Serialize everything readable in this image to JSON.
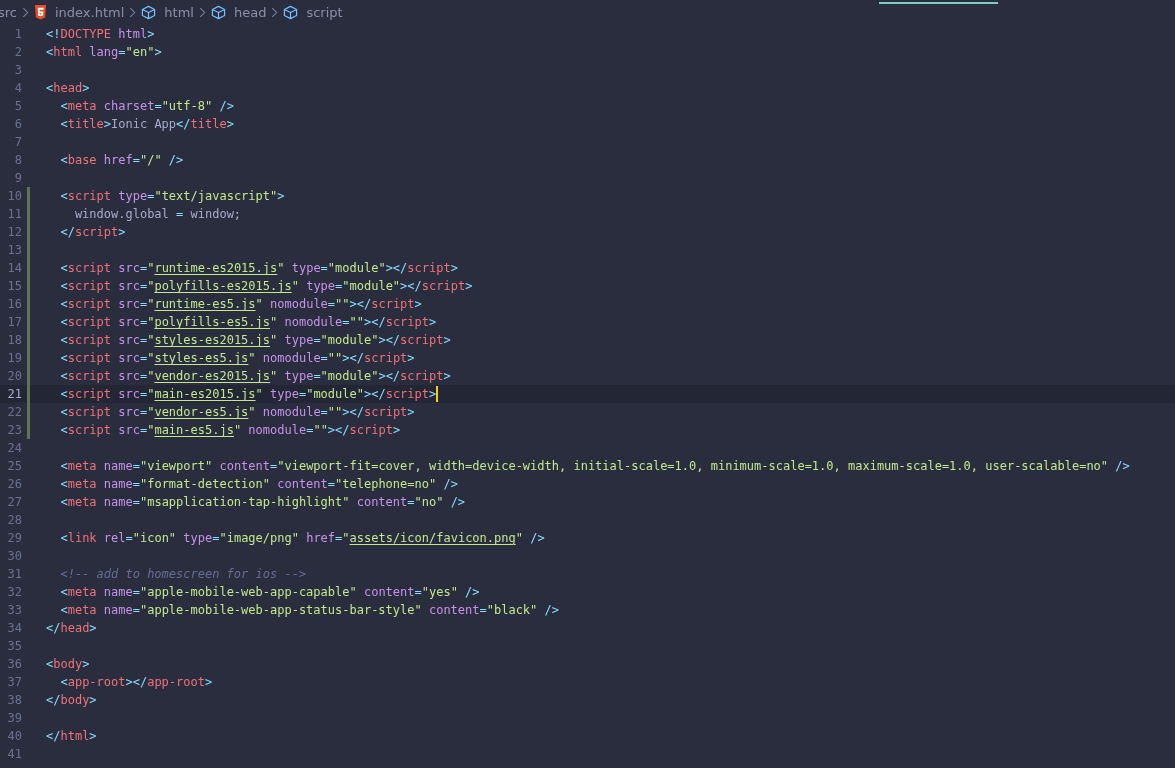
{
  "breadcrumbs": [
    {
      "kind": "folder",
      "label": "src"
    },
    {
      "kind": "file",
      "label": "index.html"
    },
    {
      "kind": "element",
      "label": "html"
    },
    {
      "kind": "element",
      "label": "head"
    },
    {
      "kind": "element",
      "label": "script"
    }
  ],
  "editor": {
    "lines": [
      {
        "number": "1",
        "changed": false,
        "current": false,
        "tokens": [
          {
            "kind": "punct",
            "text": "<!"
          },
          {
            "kind": "tag",
            "text": "DOCTYPE"
          },
          {
            "kind": "attr",
            "text": " html"
          },
          {
            "kind": "punct",
            "text": ">"
          }
        ]
      },
      {
        "number": "2",
        "changed": false,
        "current": false,
        "tokens": [
          {
            "kind": "punct",
            "text": "<"
          },
          {
            "kind": "tag",
            "text": "html"
          },
          {
            "kind": "attr",
            "text": " lang"
          },
          {
            "kind": "punct",
            "text": "="
          },
          {
            "kind": "string",
            "text": "\"en\""
          },
          {
            "kind": "punct",
            "text": ">"
          }
        ]
      },
      {
        "number": "3",
        "changed": false,
        "current": false
      },
      {
        "number": "4",
        "changed": false,
        "current": false,
        "tokens": [
          {
            "kind": "punct",
            "text": "<"
          },
          {
            "kind": "tag",
            "text": "head"
          },
          {
            "kind": "punct",
            "text": ">"
          }
        ]
      },
      {
        "number": "5",
        "changed": false,
        "current": false,
        "tokens": [
          {
            "kind": "punct",
            "text": "  <"
          },
          {
            "kind": "tag",
            "text": "meta"
          },
          {
            "kind": "attr",
            "text": " charset"
          },
          {
            "kind": "punct",
            "text": "="
          },
          {
            "kind": "string",
            "text": "\"utf-8\""
          },
          {
            "kind": "punct",
            "text": " />"
          }
        ]
      },
      {
        "number": "6",
        "changed": false,
        "current": false,
        "tokens": [
          {
            "kind": "punct",
            "text": "  <"
          },
          {
            "kind": "tag",
            "text": "title"
          },
          {
            "kind": "punct",
            "text": ">"
          },
          {
            "kind": "text",
            "text": "Ionic App"
          },
          {
            "kind": "punct",
            "text": "</"
          },
          {
            "kind": "tag",
            "text": "title"
          },
          {
            "kind": "punct",
            "text": ">"
          }
        ]
      },
      {
        "number": "7",
        "changed": false,
        "current": false
      },
      {
        "number": "8",
        "changed": false,
        "current": false,
        "tokens": [
          {
            "kind": "punct",
            "text": "  <"
          },
          {
            "kind": "tag",
            "text": "base"
          },
          {
            "kind": "attr",
            "text": " href"
          },
          {
            "kind": "punct",
            "text": "="
          },
          {
            "kind": "string",
            "text": "\"/\""
          },
          {
            "kind": "punct",
            "text": " />"
          }
        ]
      },
      {
        "number": "9",
        "changed": false,
        "current": false
      },
      {
        "number": "10",
        "changed": true,
        "current": false,
        "tokens": [
          {
            "kind": "punct",
            "text": "  <"
          },
          {
            "kind": "tag",
            "text": "script"
          },
          {
            "kind": "attr",
            "text": " type"
          },
          {
            "kind": "punct",
            "text": "="
          },
          {
            "kind": "string",
            "text": "\"text/javascript\""
          },
          {
            "kind": "punct",
            "text": ">"
          }
        ]
      },
      {
        "number": "11",
        "changed": true,
        "current": false,
        "tokens": [
          {
            "kind": "text",
            "text": "    window.global"
          },
          {
            "kind": "punct",
            "text": " ="
          },
          {
            "kind": "text",
            "text": " window;"
          }
        ]
      },
      {
        "number": "12",
        "changed": true,
        "current": false,
        "tokens": [
          {
            "kind": "punct",
            "text": "  </"
          },
          {
            "kind": "tag",
            "text": "script"
          },
          {
            "kind": "punct",
            "text": ">"
          }
        ]
      },
      {
        "number": "13",
        "changed": true,
        "current": false
      },
      {
        "number": "14",
        "changed": true,
        "current": false,
        "tokens": [
          {
            "kind": "punct",
            "text": "  <"
          },
          {
            "kind": "tag",
            "text": "script"
          },
          {
            "kind": "attr",
            "text": " src"
          },
          {
            "kind": "punct",
            "text": "="
          },
          {
            "kind": "string",
            "text": "\""
          },
          {
            "kind": "link",
            "text": "runtime-es2015.js"
          },
          {
            "kind": "string",
            "text": "\""
          },
          {
            "kind": "attr",
            "text": " type"
          },
          {
            "kind": "punct",
            "text": "="
          },
          {
            "kind": "string",
            "text": "\"module\""
          },
          {
            "kind": "punct",
            "text": "></"
          },
          {
            "kind": "tag",
            "text": "script"
          },
          {
            "kind": "punct",
            "text": ">"
          }
        ]
      },
      {
        "number": "15",
        "changed": true,
        "current": false,
        "tokens": [
          {
            "kind": "punct",
            "text": "  <"
          },
          {
            "kind": "tag",
            "text": "script"
          },
          {
            "kind": "attr",
            "text": " src"
          },
          {
            "kind": "punct",
            "text": "="
          },
          {
            "kind": "string",
            "text": "\""
          },
          {
            "kind": "link",
            "text": "polyfills-es2015.js"
          },
          {
            "kind": "string",
            "text": "\""
          },
          {
            "kind": "attr",
            "text": " type"
          },
          {
            "kind": "punct",
            "text": "="
          },
          {
            "kind": "string",
            "text": "\"module\""
          },
          {
            "kind": "punct",
            "text": "></"
          },
          {
            "kind": "tag",
            "text": "script"
          },
          {
            "kind": "punct",
            "text": ">"
          }
        ]
      },
      {
        "number": "16",
        "changed": true,
        "current": false,
        "tokens": [
          {
            "kind": "punct",
            "text": "  <"
          },
          {
            "kind": "tag",
            "text": "script"
          },
          {
            "kind": "attr",
            "text": " src"
          },
          {
            "kind": "punct",
            "text": "="
          },
          {
            "kind": "string",
            "text": "\""
          },
          {
            "kind": "link",
            "text": "runtime-es5.js"
          },
          {
            "kind": "string",
            "text": "\""
          },
          {
            "kind": "attr",
            "text": " nomodule"
          },
          {
            "kind": "punct",
            "text": "="
          },
          {
            "kind": "string",
            "text": "\"\""
          },
          {
            "kind": "punct",
            "text": "></"
          },
          {
            "kind": "tag",
            "text": "script"
          },
          {
            "kind": "punct",
            "text": ">"
          }
        ]
      },
      {
        "number": "17",
        "changed": true,
        "current": false,
        "tokens": [
          {
            "kind": "punct",
            "text": "  <"
          },
          {
            "kind": "tag",
            "text": "script"
          },
          {
            "kind": "attr",
            "text": " src"
          },
          {
            "kind": "punct",
            "text": "="
          },
          {
            "kind": "string",
            "text": "\""
          },
          {
            "kind": "link",
            "text": "polyfills-es5.js"
          },
          {
            "kind": "string",
            "text": "\""
          },
          {
            "kind": "attr",
            "text": " nomodule"
          },
          {
            "kind": "punct",
            "text": "="
          },
          {
            "kind": "string",
            "text": "\"\""
          },
          {
            "kind": "punct",
            "text": "></"
          },
          {
            "kind": "tag",
            "text": "script"
          },
          {
            "kind": "punct",
            "text": ">"
          }
        ]
      },
      {
        "number": "18",
        "changed": true,
        "current": false,
        "tokens": [
          {
            "kind": "punct",
            "text": "  <"
          },
          {
            "kind": "tag",
            "text": "script"
          },
          {
            "kind": "attr",
            "text": " src"
          },
          {
            "kind": "punct",
            "text": "="
          },
          {
            "kind": "string",
            "text": "\""
          },
          {
            "kind": "link",
            "text": "styles-es2015.js"
          },
          {
            "kind": "string",
            "text": "\""
          },
          {
            "kind": "attr",
            "text": " type"
          },
          {
            "kind": "punct",
            "text": "="
          },
          {
            "kind": "string",
            "text": "\"module\""
          },
          {
            "kind": "punct",
            "text": "></"
          },
          {
            "kind": "tag",
            "text": "script"
          },
          {
            "kind": "punct",
            "text": ">"
          }
        ]
      },
      {
        "number": "19",
        "changed": true,
        "current": false,
        "tokens": [
          {
            "kind": "punct",
            "text": "  <"
          },
          {
            "kind": "tag",
            "text": "script"
          },
          {
            "kind": "attr",
            "text": " src"
          },
          {
            "kind": "punct",
            "text": "="
          },
          {
            "kind": "string",
            "text": "\""
          },
          {
            "kind": "link",
            "text": "styles-es5.js"
          },
          {
            "kind": "string",
            "text": "\""
          },
          {
            "kind": "attr",
            "text": " nomodule"
          },
          {
            "kind": "punct",
            "text": "="
          },
          {
            "kind": "string",
            "text": "\"\""
          },
          {
            "kind": "punct",
            "text": "></"
          },
          {
            "kind": "tag",
            "text": "script"
          },
          {
            "kind": "punct",
            "text": ">"
          }
        ]
      },
      {
        "number": "20",
        "changed": true,
        "current": false,
        "tokens": [
          {
            "kind": "punct",
            "text": "  <"
          },
          {
            "kind": "tag",
            "text": "script"
          },
          {
            "kind": "attr",
            "text": " src"
          },
          {
            "kind": "punct",
            "text": "="
          },
          {
            "kind": "string",
            "text": "\""
          },
          {
            "kind": "link",
            "text": "vendor-es2015.js"
          },
          {
            "kind": "string",
            "text": "\""
          },
          {
            "kind": "attr",
            "text": " type"
          },
          {
            "kind": "punct",
            "text": "="
          },
          {
            "kind": "string",
            "text": "\"module\""
          },
          {
            "kind": "punct",
            "text": "></"
          },
          {
            "kind": "tag",
            "text": "script"
          },
          {
            "kind": "punct",
            "text": ">"
          }
        ]
      },
      {
        "number": "21",
        "changed": true,
        "current": true,
        "tokens": [
          {
            "kind": "punct",
            "text": "  <"
          },
          {
            "kind": "tag",
            "text": "script"
          },
          {
            "kind": "attr",
            "text": " src"
          },
          {
            "kind": "punct",
            "text": "="
          },
          {
            "kind": "string",
            "text": "\""
          },
          {
            "kind": "link",
            "text": "main-es2015.js"
          },
          {
            "kind": "string",
            "text": "\""
          },
          {
            "kind": "attr",
            "text": " type"
          },
          {
            "kind": "punct",
            "text": "="
          },
          {
            "kind": "string",
            "text": "\"module\""
          },
          {
            "kind": "punct",
            "text": "></"
          },
          {
            "kind": "tag",
            "text": "script"
          },
          {
            "kind": "punct",
            "text": ">"
          }
        ]
      },
      {
        "number": "22",
        "changed": true,
        "current": false,
        "tokens": [
          {
            "kind": "punct",
            "text": "  <"
          },
          {
            "kind": "tag",
            "text": "script"
          },
          {
            "kind": "attr",
            "text": " src"
          },
          {
            "kind": "punct",
            "text": "="
          },
          {
            "kind": "string",
            "text": "\""
          },
          {
            "kind": "link",
            "text": "vendor-es5.js"
          },
          {
            "kind": "string",
            "text": "\""
          },
          {
            "kind": "attr",
            "text": " nomodule"
          },
          {
            "kind": "punct",
            "text": "="
          },
          {
            "kind": "string",
            "text": "\"\""
          },
          {
            "kind": "punct",
            "text": "></"
          },
          {
            "kind": "tag",
            "text": "script"
          },
          {
            "kind": "punct",
            "text": ">"
          }
        ]
      },
      {
        "number": "23",
        "changed": true,
        "current": false,
        "tokens": [
          {
            "kind": "punct",
            "text": "  <"
          },
          {
            "kind": "tag",
            "text": "script"
          },
          {
            "kind": "attr",
            "text": " src"
          },
          {
            "kind": "punct",
            "text": "="
          },
          {
            "kind": "string",
            "text": "\""
          },
          {
            "kind": "link",
            "text": "main-es5.js"
          },
          {
            "kind": "string",
            "text": "\""
          },
          {
            "kind": "attr",
            "text": " nomodule"
          },
          {
            "kind": "punct",
            "text": "="
          },
          {
            "kind": "string",
            "text": "\"\""
          },
          {
            "kind": "punct",
            "text": "></"
          },
          {
            "kind": "tag",
            "text": "script"
          },
          {
            "kind": "punct",
            "text": ">"
          }
        ]
      },
      {
        "number": "24",
        "changed": false,
        "current": false
      },
      {
        "number": "25",
        "changed": false,
        "current": false,
        "tokens": [
          {
            "kind": "punct",
            "text": "  <"
          },
          {
            "kind": "tag",
            "text": "meta"
          },
          {
            "kind": "attr",
            "text": " name"
          },
          {
            "kind": "punct",
            "text": "="
          },
          {
            "kind": "string",
            "text": "\"viewport\""
          },
          {
            "kind": "attr",
            "text": " content"
          },
          {
            "kind": "punct",
            "text": "="
          },
          {
            "kind": "string",
            "text": "\"viewport-fit=cover, width=device-width, initial-scale=1.0, minimum-scale=1.0, maximum-scale=1.0, user-scalable=no\""
          },
          {
            "kind": "punct",
            "text": " />"
          }
        ]
      },
      {
        "number": "26",
        "changed": false,
        "current": false,
        "tokens": [
          {
            "kind": "punct",
            "text": "  <"
          },
          {
            "kind": "tag",
            "text": "meta"
          },
          {
            "kind": "attr",
            "text": " name"
          },
          {
            "kind": "punct",
            "text": "="
          },
          {
            "kind": "string",
            "text": "\"format-detection\""
          },
          {
            "kind": "attr",
            "text": " content"
          },
          {
            "kind": "punct",
            "text": "="
          },
          {
            "kind": "string",
            "text": "\"telephone=no\""
          },
          {
            "kind": "punct",
            "text": " />"
          }
        ]
      },
      {
        "number": "27",
        "changed": false,
        "current": false,
        "tokens": [
          {
            "kind": "punct",
            "text": "  <"
          },
          {
            "kind": "tag",
            "text": "meta"
          },
          {
            "kind": "attr",
            "text": " name"
          },
          {
            "kind": "punct",
            "text": "="
          },
          {
            "kind": "string",
            "text": "\"msapplication-tap-highlight\""
          },
          {
            "kind": "attr",
            "text": " content"
          },
          {
            "kind": "punct",
            "text": "="
          },
          {
            "kind": "string",
            "text": "\"no\""
          },
          {
            "kind": "punct",
            "text": " />"
          }
        ]
      },
      {
        "number": "28",
        "changed": false,
        "current": false
      },
      {
        "number": "29",
        "changed": false,
        "current": false,
        "tokens": [
          {
            "kind": "punct",
            "text": "  <"
          },
          {
            "kind": "tag",
            "text": "link"
          },
          {
            "kind": "attr",
            "text": " rel"
          },
          {
            "kind": "punct",
            "text": "="
          },
          {
            "kind": "string",
            "text": "\"icon\""
          },
          {
            "kind": "attr",
            "text": " type"
          },
          {
            "kind": "punct",
            "text": "="
          },
          {
            "kind": "string",
            "text": "\"image/png\""
          },
          {
            "kind": "attr",
            "text": " href"
          },
          {
            "kind": "punct",
            "text": "="
          },
          {
            "kind": "string",
            "text": "\""
          },
          {
            "kind": "link",
            "text": "assets/icon/favicon.png"
          },
          {
            "kind": "string",
            "text": "\""
          },
          {
            "kind": "punct",
            "text": " />"
          }
        ]
      },
      {
        "number": "30",
        "changed": false,
        "current": false
      },
      {
        "number": "31",
        "changed": false,
        "current": false,
        "tokens": [
          {
            "kind": "comment",
            "text": "  <!-- add to homescreen for ios -->"
          }
        ]
      },
      {
        "number": "32",
        "changed": false,
        "current": false,
        "tokens": [
          {
            "kind": "punct",
            "text": "  <"
          },
          {
            "kind": "tag",
            "text": "meta"
          },
          {
            "kind": "attr",
            "text": " name"
          },
          {
            "kind": "punct",
            "text": "="
          },
          {
            "kind": "string",
            "text": "\"apple-mobile-web-app-capable\""
          },
          {
            "kind": "attr",
            "text": " content"
          },
          {
            "kind": "punct",
            "text": "="
          },
          {
            "kind": "string",
            "text": "\"yes\""
          },
          {
            "kind": "punct",
            "text": " />"
          }
        ]
      },
      {
        "number": "33",
        "changed": false,
        "current": false,
        "tokens": [
          {
            "kind": "punct",
            "text": "  <"
          },
          {
            "kind": "tag",
            "text": "meta"
          },
          {
            "kind": "attr",
            "text": " name"
          },
          {
            "kind": "punct",
            "text": "="
          },
          {
            "kind": "string",
            "text": "\"apple-mobile-web-app-status-bar-style\""
          },
          {
            "kind": "attr",
            "text": " content"
          },
          {
            "kind": "punct",
            "text": "="
          },
          {
            "kind": "string",
            "text": "\"black\""
          },
          {
            "kind": "punct",
            "text": " />"
          }
        ]
      },
      {
        "number": "34",
        "changed": false,
        "current": false,
        "tokens": [
          {
            "kind": "punct",
            "text": "</"
          },
          {
            "kind": "tag",
            "text": "head"
          },
          {
            "kind": "punct",
            "text": ">"
          }
        ]
      },
      {
        "number": "35",
        "changed": false,
        "current": false
      },
      {
        "number": "36",
        "changed": false,
        "current": false,
        "tokens": [
          {
            "kind": "punct",
            "text": "<"
          },
          {
            "kind": "tag",
            "text": "body"
          },
          {
            "kind": "punct",
            "text": ">"
          }
        ]
      },
      {
        "number": "37",
        "changed": false,
        "current": false,
        "tokens": [
          {
            "kind": "punct",
            "text": "  <"
          },
          {
            "kind": "tag",
            "text": "app-root"
          },
          {
            "kind": "punct",
            "text": "></"
          },
          {
            "kind": "tag",
            "text": "app-root"
          },
          {
            "kind": "punct",
            "text": ">"
          }
        ]
      },
      {
        "number": "38",
        "changed": false,
        "current": false,
        "tokens": [
          {
            "kind": "punct",
            "text": "</"
          },
          {
            "kind": "tag",
            "text": "body"
          },
          {
            "kind": "punct",
            "text": ">"
          }
        ]
      },
      {
        "number": "39",
        "changed": false,
        "current": false
      },
      {
        "number": "40",
        "changed": false,
        "current": false,
        "tokens": [
          {
            "kind": "punct",
            "text": "</"
          },
          {
            "kind": "tag",
            "text": "html"
          },
          {
            "kind": "punct",
            "text": ">"
          }
        ]
      },
      {
        "number": "41",
        "changed": false,
        "current": false
      }
    ]
  }
}
